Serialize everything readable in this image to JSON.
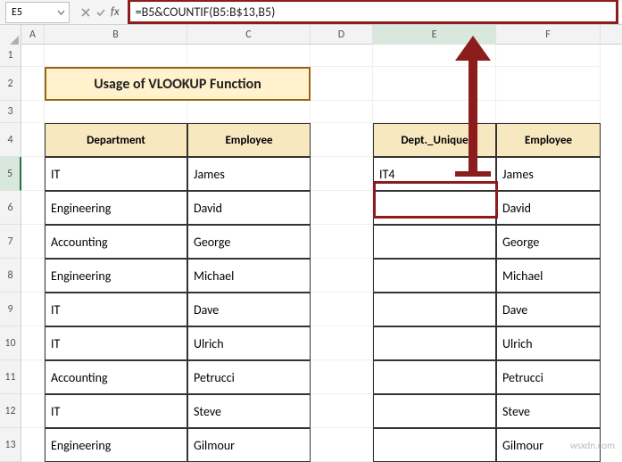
{
  "namebox": {
    "value": "E5"
  },
  "formula_bar": {
    "value": "=B5&COUNTIF(B5:B$13,B5)"
  },
  "fx_label": "fx",
  "columns": [
    "A",
    "B",
    "C",
    "D",
    "E",
    "F"
  ],
  "row_numbers": [
    "1",
    "2",
    "3",
    "4",
    "5",
    "6",
    "7",
    "8",
    "9",
    "10",
    "11",
    "12",
    "13"
  ],
  "title": "Usage of VLOOKUP Function",
  "left_table": {
    "h1": "Department",
    "h2": "Employee",
    "rows": [
      {
        "dept": "IT",
        "emp": "James"
      },
      {
        "dept": "Engineering",
        "emp": "David"
      },
      {
        "dept": "Accounting",
        "emp": "George"
      },
      {
        "dept": "Engineering",
        "emp": "Michael"
      },
      {
        "dept": "IT",
        "emp": "Dave"
      },
      {
        "dept": "IT",
        "emp": "Ulrich"
      },
      {
        "dept": "Accounting",
        "emp": "Petrucci"
      },
      {
        "dept": "IT",
        "emp": "Steve"
      },
      {
        "dept": "Engineering",
        "emp": "Gilmour"
      }
    ]
  },
  "right_table": {
    "h1": "Dept._Unique",
    "h2": "Employee",
    "rows": [
      {
        "uniq": "IT4",
        "emp": "James"
      },
      {
        "uniq": "",
        "emp": "David"
      },
      {
        "uniq": "",
        "emp": "George"
      },
      {
        "uniq": "",
        "emp": "Michael"
      },
      {
        "uniq": "",
        "emp": "Dave"
      },
      {
        "uniq": "",
        "emp": "Ulrich"
      },
      {
        "uniq": "",
        "emp": "Petrucci"
      },
      {
        "uniq": "",
        "emp": "Steve"
      },
      {
        "uniq": "",
        "emp": "Gilmour"
      }
    ]
  },
  "watermark": "wsxdn.com"
}
